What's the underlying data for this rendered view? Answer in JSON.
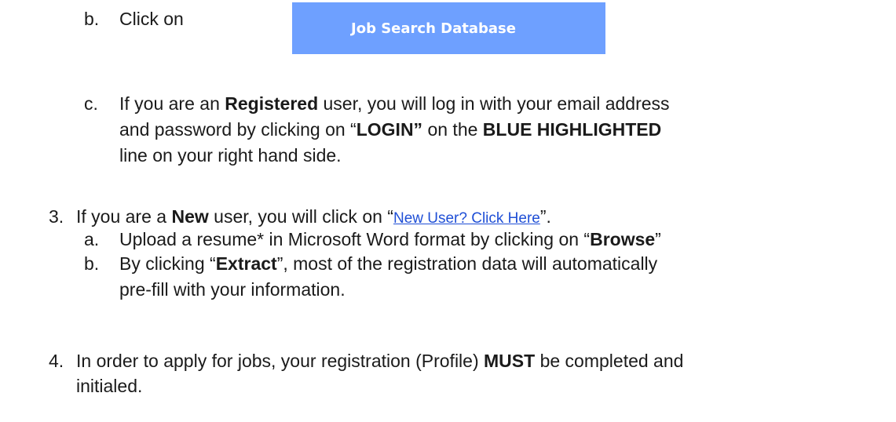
{
  "step_b_top": {
    "marker": "b.",
    "text": "Click on"
  },
  "button": {
    "label": "Job Search Database",
    "color": "#6ea0ff"
  },
  "step_c": {
    "marker": "c.",
    "l1_a": "If you are an ",
    "l1_b": "Registered",
    "l1_c": " user, you will log in with your email address",
    "l2_a": "and password by clicking on “",
    "l2_b": "LOGIN”",
    "l2_c": " on the ",
    "l2_d": "BLUE HIGHLIGHTED",
    "l3": "line on your right hand side."
  },
  "step_3": {
    "marker": "3.",
    "a": "If you are a ",
    "b": "New",
    "c": " user, you will click on “",
    "link": "New User? Click Here",
    "d": "”."
  },
  "step_3a": {
    "marker": "a.",
    "a": "Upload a resume* in Microsoft Word format by clicking on “",
    "b": "Browse",
    "c": "”"
  },
  "step_3b": {
    "marker": "b.",
    "a": "By clicking “",
    "b": "Extract",
    "c": "”, most of the registration data will automatically",
    "l2": "pre-fill with your information."
  },
  "step_4": {
    "marker": "4.",
    "a": "In order to apply for jobs, your registration (Profile) ",
    "b": "MUST",
    "c": " be completed and",
    "l2": "initialed."
  }
}
